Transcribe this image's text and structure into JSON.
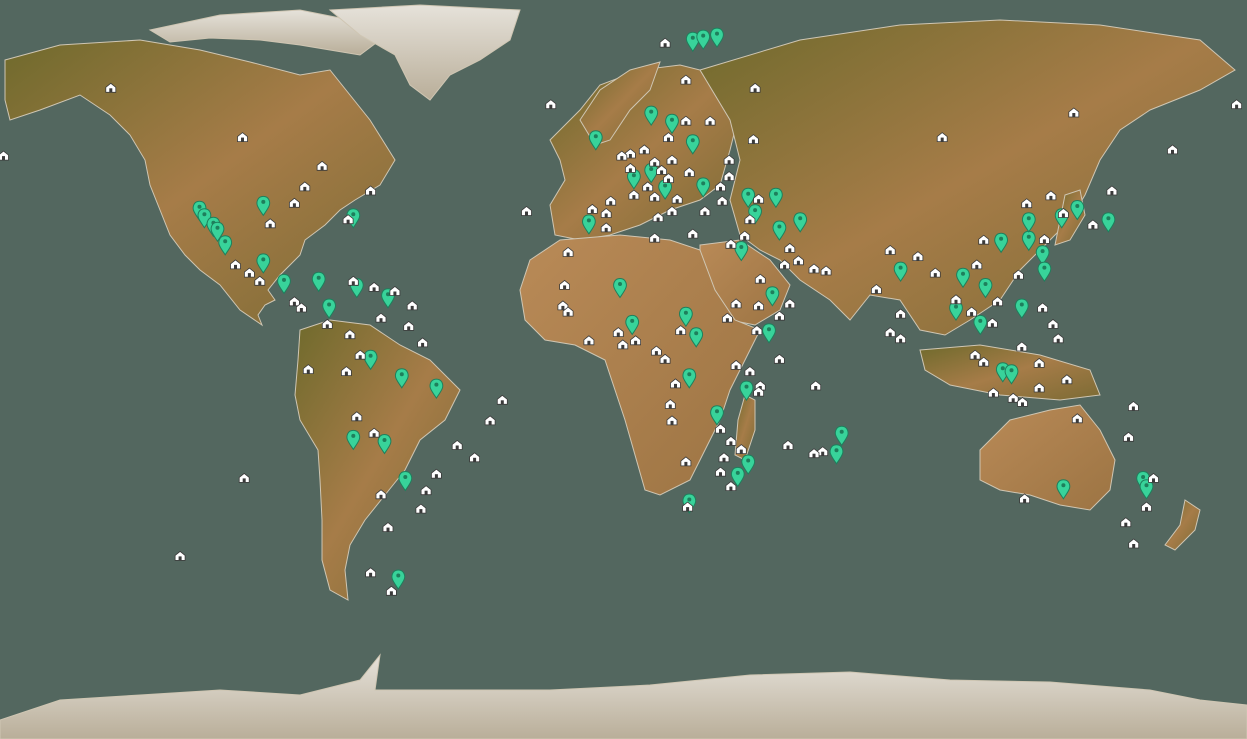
{
  "map": {
    "projection": "equirectangular",
    "colors": {
      "ocean": "#53675f",
      "land_lowland": "#a67c48",
      "land_forest": "#6f6a2c",
      "land_desert": "#b98a57",
      "ice": "#d9d4cc",
      "marker_green": "#38d39a",
      "marker_white": "#ffffff"
    },
    "marker_types": {
      "green": "map-pin-icon",
      "white": "building-icon"
    },
    "markers": {
      "green": [
        {
          "lat": 37.8,
          "lon": -122.4
        },
        {
          "lat": 36.0,
          "lon": -121.0
        },
        {
          "lat": 33.9,
          "lon": -118.4
        },
        {
          "lat": 32.7,
          "lon": -117.2
        },
        {
          "lat": 29.4,
          "lon": -115.0
        },
        {
          "lat": 39.0,
          "lon": -104.0
        },
        {
          "lat": 36.0,
          "lon": -78.0
        },
        {
          "lat": 25.0,
          "lon": -104.0
        },
        {
          "lat": 20.0,
          "lon": -98.0
        },
        {
          "lat": 20.5,
          "lon": -88.0
        },
        {
          "lat": 19.0,
          "lon": -77.0
        },
        {
          "lat": 14.0,
          "lon": -85.0
        },
        {
          "lat": 16.5,
          "lon": -68.0
        },
        {
          "lat": 1.5,
          "lon": -73.0
        },
        {
          "lat": -3.0,
          "lon": -64.0
        },
        {
          "lat": -5.5,
          "lon": -54.0
        },
        {
          "lat": -18.0,
          "lon": -78.0
        },
        {
          "lat": -19.0,
          "lon": -69.0
        },
        {
          "lat": -28.0,
          "lon": -63.0
        },
        {
          "lat": -52.0,
          "lon": -65.0
        },
        {
          "lat": 79.0,
          "lon": 20.0
        },
        {
          "lat": 79.5,
          "lon": 23.0
        },
        {
          "lat": 80.0,
          "lon": 27.0
        },
        {
          "lat": 61.0,
          "lon": 8.0
        },
        {
          "lat": 59.0,
          "lon": 14.0
        },
        {
          "lat": 55.0,
          "lon": -8.0
        },
        {
          "lat": 54.0,
          "lon": 20.0
        },
        {
          "lat": 47.0,
          "lon": 8.0
        },
        {
          "lat": 45.5,
          "lon": 3.0
        },
        {
          "lat": 43.0,
          "lon": 12.0
        },
        {
          "lat": 43.5,
          "lon": 23.0
        },
        {
          "lat": 41.0,
          "lon": 36.0
        },
        {
          "lat": 41.0,
          "lon": 44.0
        },
        {
          "lat": 37.0,
          "lon": 38.0
        },
        {
          "lat": 35.0,
          "lon": 51.0
        },
        {
          "lat": 33.0,
          "lon": 45.0
        },
        {
          "lat": 34.5,
          "lon": -10.0
        },
        {
          "lat": 28.0,
          "lon": 34.0
        },
        {
          "lat": 19.0,
          "lon": -1.0
        },
        {
          "lat": 17.0,
          "lon": 43.0
        },
        {
          "lat": 12.0,
          "lon": 18.0
        },
        {
          "lat": 10.0,
          "lon": 2.5
        },
        {
          "lat": 7.0,
          "lon": 21.0
        },
        {
          "lat": 8.0,
          "lon": 42.0
        },
        {
          "lat": -3.0,
          "lon": 19.0
        },
        {
          "lat": -6.0,
          "lon": 35.5
        },
        {
          "lat": -12.0,
          "lon": 27.0
        },
        {
          "lat": -17.0,
          "lon": 63.0
        },
        {
          "lat": -21.5,
          "lon": 61.5
        },
        {
          "lat": -24.0,
          "lon": 36.0
        },
        {
          "lat": -27.0,
          "lon": 33.0
        },
        {
          "lat": -33.5,
          "lon": 19.0
        },
        {
          "lat": 23.0,
          "lon": 80.0
        },
        {
          "lat": 19.0,
          "lon": 104.5
        },
        {
          "lat": 14.0,
          "lon": 115.0
        },
        {
          "lat": 13.5,
          "lon": 96.0
        },
        {
          "lat": 10.0,
          "lon": 103.0
        },
        {
          "lat": 21.5,
          "lon": 98.0
        },
        {
          "lat": 30.0,
          "lon": 109.0
        },
        {
          "lat": 30.5,
          "lon": 117.0
        },
        {
          "lat": 35.0,
          "lon": 117.0
        },
        {
          "lat": 27.0,
          "lon": 121.0
        },
        {
          "lat": 23.0,
          "lon": 121.5
        },
        {
          "lat": 36.0,
          "lon": 126.5
        },
        {
          "lat": 38.0,
          "lon": 131.0
        },
        {
          "lat": 35.0,
          "lon": 140.0
        },
        {
          "lat": -1.5,
          "lon": 109.5
        },
        {
          "lat": -2.0,
          "lon": 112.0
        },
        {
          "lat": -30.0,
          "lon": 127.0
        },
        {
          "lat": -28.0,
          "lon": 150.0
        },
        {
          "lat": -30.0,
          "lon": 151.0
        }
      ],
      "white": [
        {
          "lat": 68.0,
          "lon": -148.0
        },
        {
          "lat": 51.5,
          "lon": -179.0
        },
        {
          "lat": 56.0,
          "lon": -110.0
        },
        {
          "lat": 49.0,
          "lon": -87.0
        },
        {
          "lat": 40.0,
          "lon": -95.0
        },
        {
          "lat": 44.0,
          "lon": -92.0
        },
        {
          "lat": 43.0,
          "lon": -73.0
        },
        {
          "lat": 35.0,
          "lon": -102.0
        },
        {
          "lat": 36.0,
          "lon": -79.5
        },
        {
          "lat": 25.0,
          "lon": -112.0
        },
        {
          "lat": 23.0,
          "lon": -108.0
        },
        {
          "lat": 21.0,
          "lon": -105.0
        },
        {
          "lat": 16.0,
          "lon": -95.0
        },
        {
          "lat": 14.5,
          "lon": -93.0
        },
        {
          "lat": 10.5,
          "lon": -85.5
        },
        {
          "lat": 8.0,
          "lon": -79.0
        },
        {
          "lat": 21.0,
          "lon": -78.0
        },
        {
          "lat": 19.5,
          "lon": -72.0
        },
        {
          "lat": 18.5,
          "lon": -66.0
        },
        {
          "lat": 15.0,
          "lon": -61.0
        },
        {
          "lat": 12.0,
          "lon": -70.0
        },
        {
          "lat": 10.0,
          "lon": -62.0
        },
        {
          "lat": 6.0,
          "lon": -58.0
        },
        {
          "lat": 3.0,
          "lon": -76.0
        },
        {
          "lat": -1.0,
          "lon": -80.0
        },
        {
          "lat": -0.5,
          "lon": -91.0
        },
        {
          "lat": -12.0,
          "lon": -77.0
        },
        {
          "lat": -16.0,
          "lon": -72.0
        },
        {
          "lat": -22.0,
          "lon": -43.0
        },
        {
          "lat": -13.0,
          "lon": -38.5
        },
        {
          "lat": -8.0,
          "lon": -35.0
        },
        {
          "lat": -19.0,
          "lon": -48.0
        },
        {
          "lat": -26.0,
          "lon": -54.0
        },
        {
          "lat": -30.0,
          "lon": -57.0
        },
        {
          "lat": -34.5,
          "lon": -58.5
        },
        {
          "lat": -31.0,
          "lon": -70.0
        },
        {
          "lat": -39.0,
          "lon": -68.0
        },
        {
          "lat": -50.0,
          "lon": -73.0
        },
        {
          "lat": -54.5,
          "lon": -67.0
        },
        {
          "lat": -27.0,
          "lon": -109.5
        },
        {
          "lat": -46.0,
          "lon": -128.0
        },
        {
          "lat": 79.0,
          "lon": 12.0
        },
        {
          "lat": 64.0,
          "lon": -21.0
        },
        {
          "lat": 70.0,
          "lon": 18.0
        },
        {
          "lat": 68.0,
          "lon": 38.0
        },
        {
          "lat": 60.0,
          "lon": 18.0
        },
        {
          "lat": 60.0,
          "lon": 25.0
        },
        {
          "lat": 56.0,
          "lon": 13.0
        },
        {
          "lat": 55.5,
          "lon": 37.5
        },
        {
          "lat": 53.0,
          "lon": 6.0
        },
        {
          "lat": 52.0,
          "lon": 2.0
        },
        {
          "lat": 51.5,
          "lon": -0.5
        },
        {
          "lat": 50.0,
          "lon": 9.0
        },
        {
          "lat": 50.5,
          "lon": 14.0
        },
        {
          "lat": 48.5,
          "lon": 2.0
        },
        {
          "lat": 48.0,
          "lon": 11.0
        },
        {
          "lat": 47.5,
          "lon": 19.0
        },
        {
          "lat": 46.0,
          "lon": 13.0
        },
        {
          "lat": 44.0,
          "lon": 7.0
        },
        {
          "lat": 42.0,
          "lon": 3.0
        },
        {
          "lat": 41.5,
          "lon": 9.0
        },
        {
          "lat": 41.0,
          "lon": 15.5
        },
        {
          "lat": 40.5,
          "lon": -3.7
        },
        {
          "lat": 38.5,
          "lon": -9.0
        },
        {
          "lat": 37.5,
          "lon": -5.0
        },
        {
          "lat": 38.0,
          "lon": 14.0
        },
        {
          "lat": 38.0,
          "lon": 23.5
        },
        {
          "lat": 40.5,
          "lon": 28.5
        },
        {
          "lat": 44.0,
          "lon": 28.0
        },
        {
          "lat": 46.5,
          "lon": 30.5
        },
        {
          "lat": 50.5,
          "lon": 30.5
        },
        {
          "lat": 41.0,
          "lon": 39.0
        },
        {
          "lat": 36.0,
          "lon": 36.5
        },
        {
          "lat": 32.0,
          "lon": 35.0
        },
        {
          "lat": 36.5,
          "lon": 10.0
        },
        {
          "lat": 34.0,
          "lon": -5.0
        },
        {
          "lat": 31.5,
          "lon": 9.0
        },
        {
          "lat": 30.0,
          "lon": 31.0
        },
        {
          "lat": 32.5,
          "lon": 20.0
        },
        {
          "lat": 28.0,
          "lon": -16.0
        },
        {
          "lat": 38.0,
          "lon": -28.0
        },
        {
          "lat": 20.0,
          "lon": -17.0
        },
        {
          "lat": 15.0,
          "lon": -17.5
        },
        {
          "lat": 13.5,
          "lon": -16.0
        },
        {
          "lat": 6.5,
          "lon": -10.0
        },
        {
          "lat": 8.5,
          "lon": -1.5
        },
        {
          "lat": 5.5,
          "lon": -0.2
        },
        {
          "lat": 6.5,
          "lon": 3.5
        },
        {
          "lat": 4.0,
          "lon": 9.5
        },
        {
          "lat": 2.0,
          "lon": 12.0
        },
        {
          "lat": 9.0,
          "lon": 16.5
        },
        {
          "lat": 12.0,
          "lon": 30.0
        },
        {
          "lat": 15.5,
          "lon": 32.5
        },
        {
          "lat": 15.0,
          "lon": 39.0
        },
        {
          "lat": 9.0,
          "lon": 38.5
        },
        {
          "lat": 2.0,
          "lon": 45.0
        },
        {
          "lat": 12.5,
          "lon": 45.0
        },
        {
          "lat": 15.5,
          "lon": 48.0
        },
        {
          "lat": 24.0,
          "lon": 55.0
        },
        {
          "lat": 23.5,
          "lon": 58.5
        },
        {
          "lat": 26.0,
          "lon": 50.5
        },
        {
          "lat": 29.0,
          "lon": 48.0
        },
        {
          "lat": 25.0,
          "lon": 46.5
        },
        {
          "lat": 21.5,
          "lon": 39.5
        },
        {
          "lat": 0.5,
          "lon": 32.5
        },
        {
          "lat": -1.0,
          "lon": 36.5
        },
        {
          "lat": -4.5,
          "lon": 39.5
        },
        {
          "lat": -6.0,
          "lon": 39.0
        },
        {
          "lat": -4.0,
          "lon": 15.0
        },
        {
          "lat": -9.0,
          "lon": 13.5
        },
        {
          "lat": -13.0,
          "lon": 14.0
        },
        {
          "lat": -15.0,
          "lon": 28.0
        },
        {
          "lat": -18.0,
          "lon": 31.0
        },
        {
          "lat": -20.0,
          "lon": 34.0
        },
        {
          "lat": -22.0,
          "lon": 29.0
        },
        {
          "lat": -25.5,
          "lon": 28.0
        },
        {
          "lat": -23.0,
          "lon": 18.0
        },
        {
          "lat": -34.0,
          "lon": 18.5
        },
        {
          "lat": -29.0,
          "lon": 31.0
        },
        {
          "lat": -19.0,
          "lon": 47.5
        },
        {
          "lat": -20.5,
          "lon": 57.5
        },
        {
          "lat": -4.5,
          "lon": 55.5
        },
        {
          "lat": -21.0,
          "lon": 55.0
        },
        {
          "lat": 28.5,
          "lon": 77.0
        },
        {
          "lat": 27.0,
          "lon": 85.0
        },
        {
          "lat": 23.0,
          "lon": 90.0
        },
        {
          "lat": 19.0,
          "lon": 73.0
        },
        {
          "lat": 13.0,
          "lon": 80.0
        },
        {
          "lat": 8.5,
          "lon": 77.0
        },
        {
          "lat": 7.0,
          "lon": 80.0
        },
        {
          "lat": 16.5,
          "lon": 96.0
        },
        {
          "lat": 13.5,
          "lon": 100.5
        },
        {
          "lat": 3.0,
          "lon": 101.5
        },
        {
          "lat": 1.3,
          "lon": 104.0
        },
        {
          "lat": 16.0,
          "lon": 108.0
        },
        {
          "lat": 10.8,
          "lon": 106.5
        },
        {
          "lat": 22.5,
          "lon": 114.0
        },
        {
          "lat": 25.0,
          "lon": 102.0
        },
        {
          "lat": 31.0,
          "lon": 104.0
        },
        {
          "lat": 31.2,
          "lon": 121.5
        },
        {
          "lat": 39.9,
          "lon": 116.4
        },
        {
          "lat": 41.8,
          "lon": 123.4
        },
        {
          "lat": 37.5,
          "lon": 127.0
        },
        {
          "lat": 43.0,
          "lon": 141.0
        },
        {
          "lat": 34.7,
          "lon": 135.5
        },
        {
          "lat": 14.5,
          "lon": 121.0
        },
        {
          "lat": 10.5,
          "lon": 124.0
        },
        {
          "lat": 7.0,
          "lon": 125.5
        },
        {
          "lat": 5.0,
          "lon": 115.0
        },
        {
          "lat": -6.2,
          "lon": 106.8
        },
        {
          "lat": -7.5,
          "lon": 112.5
        },
        {
          "lat": -8.5,
          "lon": 115.2
        },
        {
          "lat": -5.0,
          "lon": 120.0
        },
        {
          "lat": -3.0,
          "lon": 128.0
        },
        {
          "lat": 56.0,
          "lon": 92.0
        },
        {
          "lat": 62.0,
          "lon": 130.0
        },
        {
          "lat": 64.0,
          "lon": 177.0
        },
        {
          "lat": 53.0,
          "lon": 158.5
        },
        {
          "lat": -27.0,
          "lon": 153.0
        },
        {
          "lat": -34.0,
          "lon": 151.0
        },
        {
          "lat": -32.0,
          "lon": 115.8
        },
        {
          "lat": -37.8,
          "lon": 145.0
        },
        {
          "lat": -43.0,
          "lon": 147.3
        },
        {
          "lat": -12.5,
          "lon": 131.0
        },
        {
          "lat": -17.0,
          "lon": 145.8
        },
        {
          "lat": -9.5,
          "lon": 147.2
        },
        {
          "lat": 1.0,
          "lon": 120.0
        }
      ]
    }
  }
}
